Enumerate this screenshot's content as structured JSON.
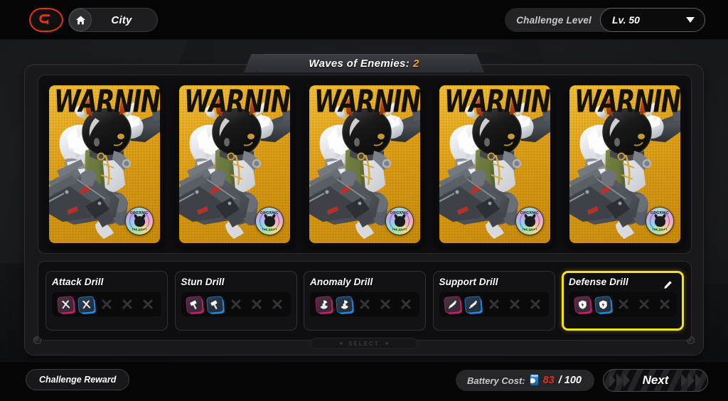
{
  "topbar": {
    "back_icon": "back-arrow-icon",
    "home_icon": "home-icon",
    "location_label": "City",
    "challenge_level_label": "Challenge Level",
    "challenge_level_value": "Lv. 50",
    "caret_icon": "chevron-down-icon"
  },
  "waves": {
    "label": "Waves of Enemies:",
    "count": "2"
  },
  "enemy_cards": [
    {
      "banner": "WARNING",
      "badge_top": "ORGANIC",
      "badge_bottom": "THE DRIFT"
    },
    {
      "banner": "WARNING",
      "badge_top": "ORGANIC",
      "badge_bottom": "THE DRIFT"
    },
    {
      "banner": "WARNING",
      "badge_top": "ORGANIC",
      "badge_bottom": "THE DRIFT"
    },
    {
      "banner": "WARNING",
      "badge_top": "ORGANIC",
      "badge_bottom": "THE DRIFT"
    },
    {
      "banner": "WARNING",
      "badge_top": "ORGANIC",
      "badge_bottom": "THE DRIFT"
    }
  ],
  "drills": [
    {
      "name": "Attack Drill",
      "selected": false,
      "edit_icon": null,
      "slots": [
        {
          "state": "filled",
          "color": "pink",
          "icon": "sword-cross-icon"
        },
        {
          "state": "filled",
          "color": "blue",
          "icon": "sword-cross-icon"
        },
        {
          "state": "empty",
          "icon": "empty-slot-x-icon"
        },
        {
          "state": "empty",
          "icon": "empty-slot-x-icon"
        },
        {
          "state": "empty",
          "icon": "empty-slot-x-icon"
        }
      ]
    },
    {
      "name": "Stun Drill",
      "selected": false,
      "edit_icon": null,
      "slots": [
        {
          "state": "filled",
          "color": "pink",
          "icon": "hammer-icon"
        },
        {
          "state": "filled",
          "color": "blue",
          "icon": "hammer-icon"
        },
        {
          "state": "empty",
          "icon": "empty-slot-x-icon"
        },
        {
          "state": "empty",
          "icon": "empty-slot-x-icon"
        },
        {
          "state": "empty",
          "icon": "empty-slot-x-icon"
        }
      ]
    },
    {
      "name": "Anomaly Drill",
      "selected": false,
      "edit_icon": null,
      "slots": [
        {
          "state": "filled",
          "color": "pink",
          "icon": "radiation-icon"
        },
        {
          "state": "filled",
          "color": "blue",
          "icon": "radiation-icon"
        },
        {
          "state": "empty",
          "icon": "empty-slot-x-icon"
        },
        {
          "state": "empty",
          "icon": "empty-slot-x-icon"
        },
        {
          "state": "empty",
          "icon": "empty-slot-x-icon"
        }
      ]
    },
    {
      "name": "Support Drill",
      "selected": false,
      "edit_icon": null,
      "slots": [
        {
          "state": "filled",
          "color": "pink",
          "icon": "syringe-icon"
        },
        {
          "state": "filled",
          "color": "blue",
          "icon": "syringe-icon"
        },
        {
          "state": "empty",
          "icon": "empty-slot-x-icon"
        },
        {
          "state": "empty",
          "icon": "empty-slot-x-icon"
        },
        {
          "state": "empty",
          "icon": "empty-slot-x-icon"
        }
      ]
    },
    {
      "name": "Defense Drill",
      "selected": true,
      "edit_icon": "pencil-edit-icon",
      "slots": [
        {
          "state": "filled",
          "color": "pink",
          "icon": "shield-icon"
        },
        {
          "state": "filled",
          "color": "blue",
          "icon": "shield-icon"
        },
        {
          "state": "empty",
          "icon": "empty-slot-x-icon"
        },
        {
          "state": "empty",
          "icon": "empty-slot-x-icon"
        },
        {
          "state": "empty",
          "icon": "empty-slot-x-icon"
        }
      ]
    }
  ],
  "select_strip": {
    "label": "SELECT"
  },
  "bottombar": {
    "challenge_reward_label": "Challenge Reward",
    "battery_label": "Battery Cost:",
    "battery_icon": "battery-can-icon",
    "battery_current": "83",
    "battery_max": "/ 100",
    "next_label": "Next"
  },
  "colors": {
    "accent_yellow": "#f5e218",
    "warning_gold": "#e6a81f",
    "battery_red": "#e02b20",
    "wave_orange": "#f5a623",
    "back_red": "#e8330f",
    "chip_pink": "#d8186f",
    "chip_blue": "#1a8fe0"
  }
}
